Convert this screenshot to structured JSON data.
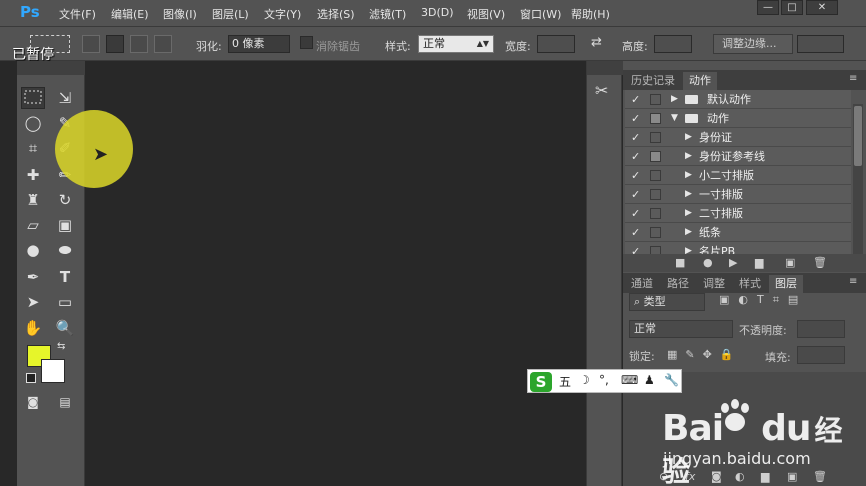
{
  "app": {
    "logo": "Ps"
  },
  "menu": [
    "文件(F)",
    "编辑(E)",
    "图像(I)",
    "图层(L)",
    "文字(Y)",
    "选择(S)",
    "滤镜(T)",
    "3D(D)",
    "视图(V)",
    "窗口(W)",
    "帮助(H)"
  ],
  "window_buttons": [
    "—",
    "□",
    "✕"
  ],
  "options": {
    "feather_label": "羽化:",
    "feather_value": "0 像素",
    "antialias_label": "消除锯齿",
    "style_label": "样式:",
    "style_value": "正常",
    "width_label": "宽度:",
    "height_label": "高度:",
    "refine_edge": "调整边缘..."
  },
  "overlay": {
    "paused": "已暂停"
  },
  "tools": {
    "icons": [
      "marquee-icon",
      "move-icon",
      "lasso-icon",
      "quick-select-icon",
      "crop-icon",
      "eyedropper-icon",
      "healing-icon",
      "brush-icon",
      "stamp-icon",
      "history-brush-icon",
      "eraser-icon",
      "gradient-icon",
      "blur-icon",
      "dodge-icon",
      "pen-icon",
      "type-icon",
      "path-select-icon",
      "shape-icon",
      "hand-icon",
      "zoom-icon"
    ],
    "fg_color": "#e6f52a",
    "bg_color": "#ffffff",
    "type_glyph": "T"
  },
  "panels": {
    "top_tabs": [
      "历史记录",
      "动作"
    ],
    "actions": [
      {
        "label": "默认动作",
        "type": "set",
        "expanded": false,
        "box": false
      },
      {
        "label": "动作",
        "type": "set",
        "expanded": true,
        "box": true
      },
      {
        "label": "身份证",
        "type": "action",
        "box": false
      },
      {
        "label": "身份证参考线",
        "type": "action",
        "box": true
      },
      {
        "label": "小二寸排版",
        "type": "action",
        "box": false
      },
      {
        "label": "一寸排版",
        "type": "action",
        "box": false
      },
      {
        "label": "二寸排版",
        "type": "action",
        "box": false
      },
      {
        "label": "纸条",
        "type": "action",
        "box": false
      },
      {
        "label": "名片PB",
        "type": "action",
        "box": false
      }
    ],
    "check_mark": "✓",
    "layer_tabs": [
      "通道",
      "路径",
      "调整",
      "样式",
      "图层"
    ],
    "layer_filter": "类型",
    "blend_mode": "正常",
    "opacity_label": "不透明度:",
    "lock_label": "锁定:",
    "fill_label": "填充:",
    "footer_icons": [
      "link-icon",
      "fx-icon",
      "mask-icon",
      "adjustment-icon",
      "group-icon",
      "new-layer-icon",
      "trash-icon"
    ]
  },
  "ime": {
    "logo": "S",
    "mode": "五",
    "items": [
      "☽",
      "°,",
      "⌨",
      "♟",
      "🔧"
    ]
  },
  "watermark": {
    "brand": "Bai",
    "brand2": "du",
    "site_cn": "经验",
    "url": "jingyan.baidu.com"
  }
}
